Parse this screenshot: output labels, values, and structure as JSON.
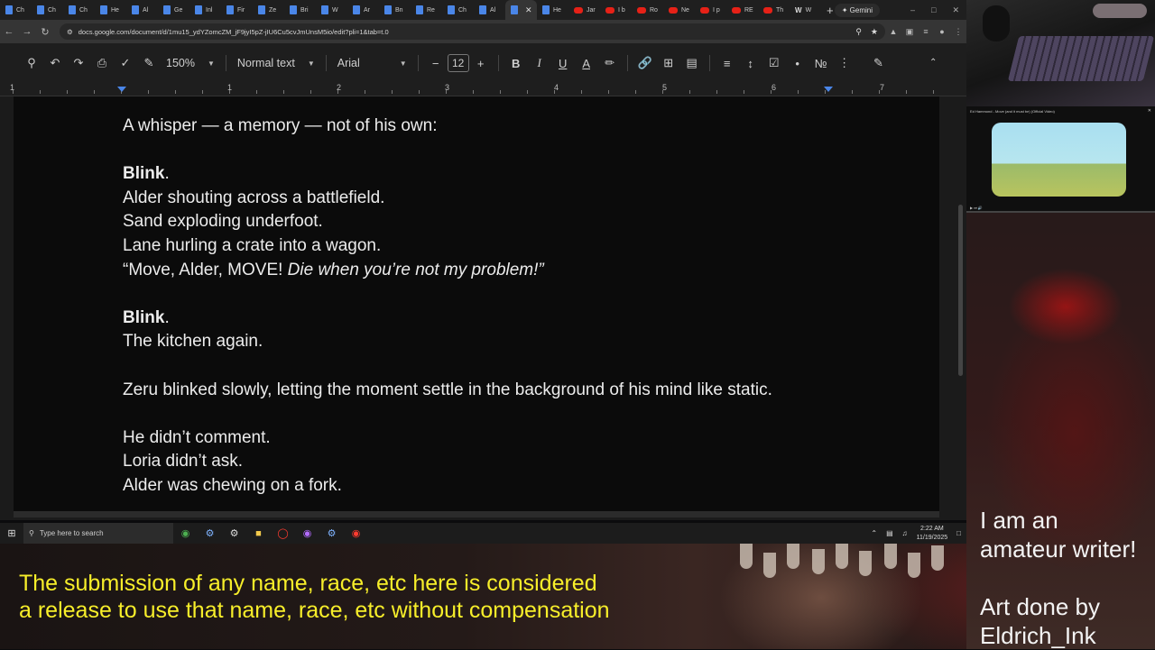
{
  "browser": {
    "tabs": [
      {
        "label": "Ch",
        "icon": "doc"
      },
      {
        "label": "Ch",
        "icon": "doc"
      },
      {
        "label": "Ch",
        "icon": "doc"
      },
      {
        "label": "He",
        "icon": "doc"
      },
      {
        "label": "Al",
        "icon": "doc"
      },
      {
        "label": "Ge",
        "icon": "doc"
      },
      {
        "label": "Inl",
        "icon": "doc"
      },
      {
        "label": "Fir",
        "icon": "doc"
      },
      {
        "label": "Ze",
        "icon": "doc"
      },
      {
        "label": "Bri",
        "icon": "doc"
      },
      {
        "label": "W",
        "icon": "doc"
      },
      {
        "label": "Ar",
        "icon": "doc"
      },
      {
        "label": "Bn",
        "icon": "doc"
      },
      {
        "label": "Re",
        "icon": "doc"
      },
      {
        "label": "Ch",
        "icon": "doc"
      },
      {
        "label": "Al",
        "icon": "doc"
      },
      {
        "label": "",
        "icon": "doc",
        "active": true
      },
      {
        "label": "He",
        "icon": "doc"
      },
      {
        "label": "Jar",
        "icon": "yt"
      },
      {
        "label": "I b",
        "icon": "yt"
      },
      {
        "label": "Ro",
        "icon": "yt"
      },
      {
        "label": "Ne",
        "icon": "yt"
      },
      {
        "label": "I p",
        "icon": "yt"
      },
      {
        "label": "RE",
        "icon": "yt"
      },
      {
        "label": "Th",
        "icon": "yt"
      },
      {
        "label": "W",
        "icon": "w"
      }
    ],
    "new_tab": "+",
    "gemini_label": "Gemini",
    "url": "docs.google.com/document/d/1mu15_ydYZomcZM_jF9jyI5pZ-jIU6Cu5cvJmUnsM5io/edit?pli=1&tab=t.0"
  },
  "toolbar": {
    "zoom": "150%",
    "style": "Normal text",
    "font": "Arial",
    "font_size": "12",
    "bold": "B",
    "italic": "I",
    "underline": "U",
    "text_color": "A"
  },
  "ruler": {
    "numbers": [
      "1",
      "1",
      "2",
      "3",
      "4",
      "5",
      "6",
      "7"
    ]
  },
  "document": {
    "l1": "A whisper — a memory — not of his own:",
    "blink1": "Blink",
    "blink1_dot": ".",
    "l3": "Alder shouting across a battlefield.",
    "l4": "Sand exploding underfoot.",
    "l5": "Lane hurling a crate into a wagon.",
    "l6a": "“Move, Alder, MOVE! ",
    "l6b": "Die when you’re not my problem!”",
    "blink2": "Blink",
    "blink2_dot": ".",
    "l8": "The kitchen again.",
    "l9": "Zeru blinked slowly, letting the moment settle in the background of his mind like static.",
    "l10": "He didn’t comment.",
    "l11": "Loria didn’t ask.",
    "l12": "Alder was chewing on a fork."
  },
  "taskbar": {
    "search_placeholder": "Type here to search",
    "time": "2:22 AM",
    "date": "11/19/2025"
  },
  "overlay": {
    "youtube_title": "Ed Hammond - Move (and it must be) (Official Video)",
    "disclaimer_line1": "The submission of any name, race, etc here is considered",
    "disclaimer_line2": "a release to use that name, race, etc without compensation",
    "writer_line1": "I am an",
    "writer_line2": "amateur writer!",
    "credit_line1": "Art done by",
    "credit_line2": "Eldrich_Ink"
  },
  "colors": {
    "doc_bg": "#0b0b0b",
    "doc_text": "#ececec",
    "accent_blue": "#4a86e8",
    "disclaimer_yellow": "#f7ee2a"
  }
}
